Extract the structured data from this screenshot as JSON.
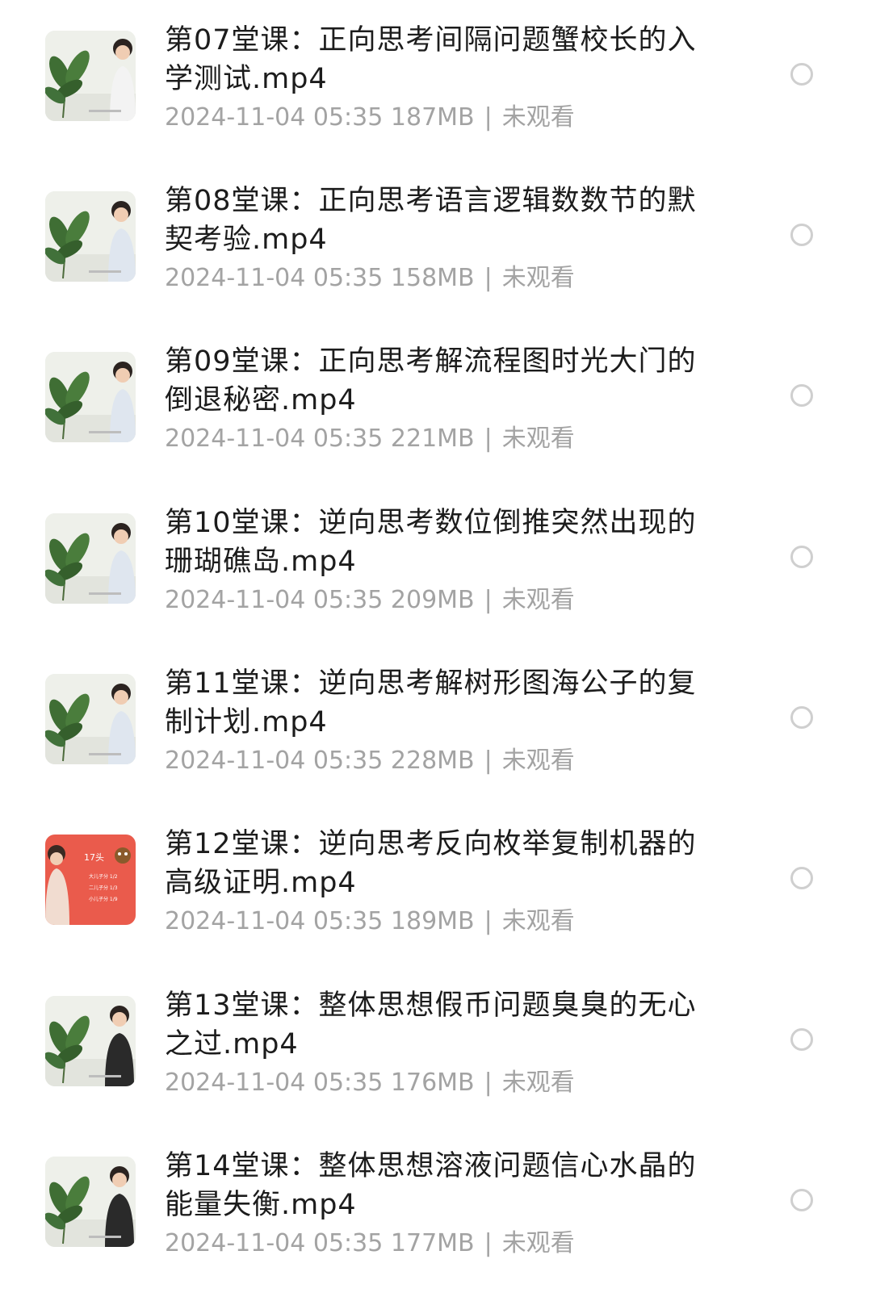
{
  "files": [
    {
      "name": "第07堂课：正向思考间隔问题蟹校长的入学测试.mp4",
      "date": "2024-11-04 05:35",
      "size": "187MB",
      "status": "未观看",
      "thumbnail": "video-thumbnail-teacher-plant"
    },
    {
      "name": "第08堂课：正向思考语言逻辑数数节的默契考验.mp4",
      "date": "2024-11-04 05:35",
      "size": "158MB",
      "status": "未观看",
      "thumbnail": "video-thumbnail-teacher-plant"
    },
    {
      "name": "第09堂课：正向思考解流程图时光大门的倒退秘密.mp4",
      "date": "2024-11-04 05:35",
      "size": "221MB",
      "status": "未观看",
      "thumbnail": "video-thumbnail-teacher-plant"
    },
    {
      "name": "第10堂课：逆向思考数位倒推突然出现的珊瑚礁岛.mp4",
      "date": "2024-11-04 05:35",
      "size": "209MB",
      "status": "未观看",
      "thumbnail": "video-thumbnail-teacher-plant"
    },
    {
      "name": "第11堂课：逆向思考解树形图海公子的复制计划.mp4",
      "date": "2024-11-04 05:35",
      "size": "228MB",
      "status": "未观看",
      "thumbnail": "video-thumbnail-teacher-plant"
    },
    {
      "name": "第12堂课：逆向思考反向枚举复制机器的高级证明.mp4",
      "date": "2024-11-04 05:35",
      "size": "189MB",
      "status": "未观看",
      "thumbnail": "video-thumbnail-red-slide",
      "thumb_text": [
        "17头",
        "大儿子分 1/2",
        "二儿子分 1/3",
        "小儿子分 1/9"
      ]
    },
    {
      "name": "第13堂课：整体思想假币问题臭臭的无心之过.mp4",
      "date": "2024-11-04 05:35",
      "size": "176MB",
      "status": "未观看",
      "thumbnail": "video-thumbnail-teacher-plant"
    },
    {
      "name": "第14堂课：整体思想溶液问题信心水晶的能量失衡.mp4",
      "date": "2024-11-04 05:35",
      "size": "177MB",
      "status": "未观看",
      "thumbnail": "video-thumbnail-teacher-plant"
    }
  ],
  "colors": {
    "title": "#1c1c1c",
    "meta": "#a3a3a3",
    "radio_border": "#cfcfcf",
    "thumb_red": "#ea5b4c",
    "plant_green": "#3f6e34"
  }
}
